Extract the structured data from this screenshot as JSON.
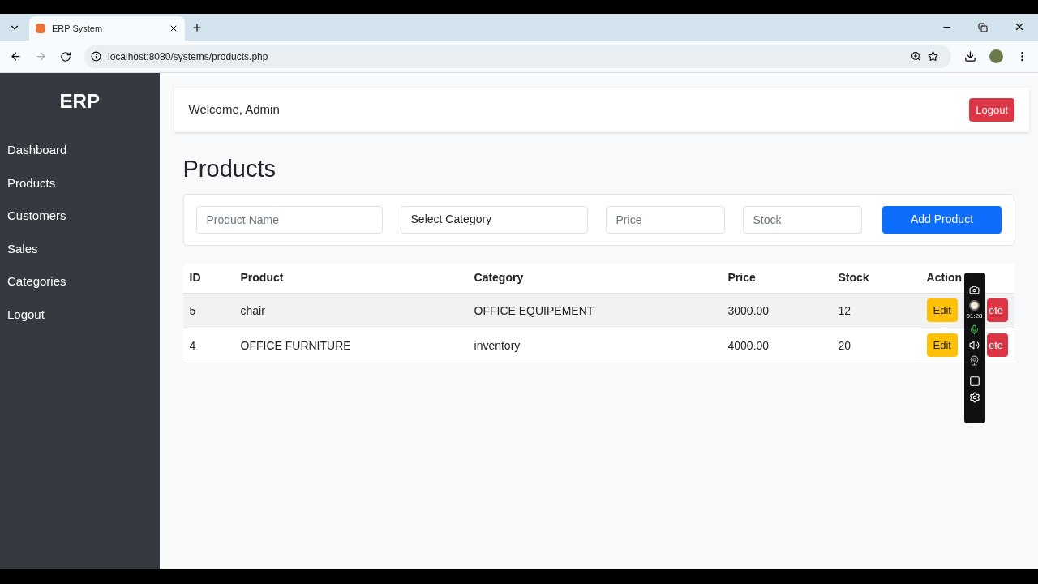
{
  "browser": {
    "tab_title": "ERP System",
    "url": "localhost:8080/systems/products.php"
  },
  "sidebar": {
    "brand": "ERP",
    "items": [
      {
        "label": "Dashboard",
        "selected": false
      },
      {
        "label": "Products",
        "selected": false
      },
      {
        "label": "Customers",
        "selected": false
      },
      {
        "label": "Sales",
        "selected": false
      },
      {
        "label": "Categories",
        "selected": false
      },
      {
        "label": "Logout",
        "selected": false
      }
    ]
  },
  "header": {
    "welcome": "Welcome, Admin",
    "logout": "Logout"
  },
  "page_title": "Products",
  "form": {
    "fields": [
      {
        "kind": "input",
        "placeholder": "Product Name"
      },
      {
        "kind": "select",
        "value": "Select Category"
      },
      {
        "kind": "input",
        "placeholder": "Price"
      },
      {
        "kind": "input",
        "placeholder": "Stock"
      }
    ],
    "submit": "Add Product"
  },
  "table": {
    "columns": [
      "ID",
      "Product",
      "Category",
      "Price",
      "Stock",
      "Action"
    ],
    "rows": [
      {
        "cells": [
          "5",
          "chair",
          "OFFICE EQUIPEMENT",
          "3000.00",
          "12"
        ],
        "edit": "Edit",
        "delete": "ete"
      },
      {
        "cells": [
          "4",
          "OFFICE FURNITURE",
          "inventory",
          "4000.00",
          "20"
        ],
        "edit": "Edit",
        "delete": "ete"
      }
    ]
  },
  "recorder": {
    "timer": "01:28"
  }
}
